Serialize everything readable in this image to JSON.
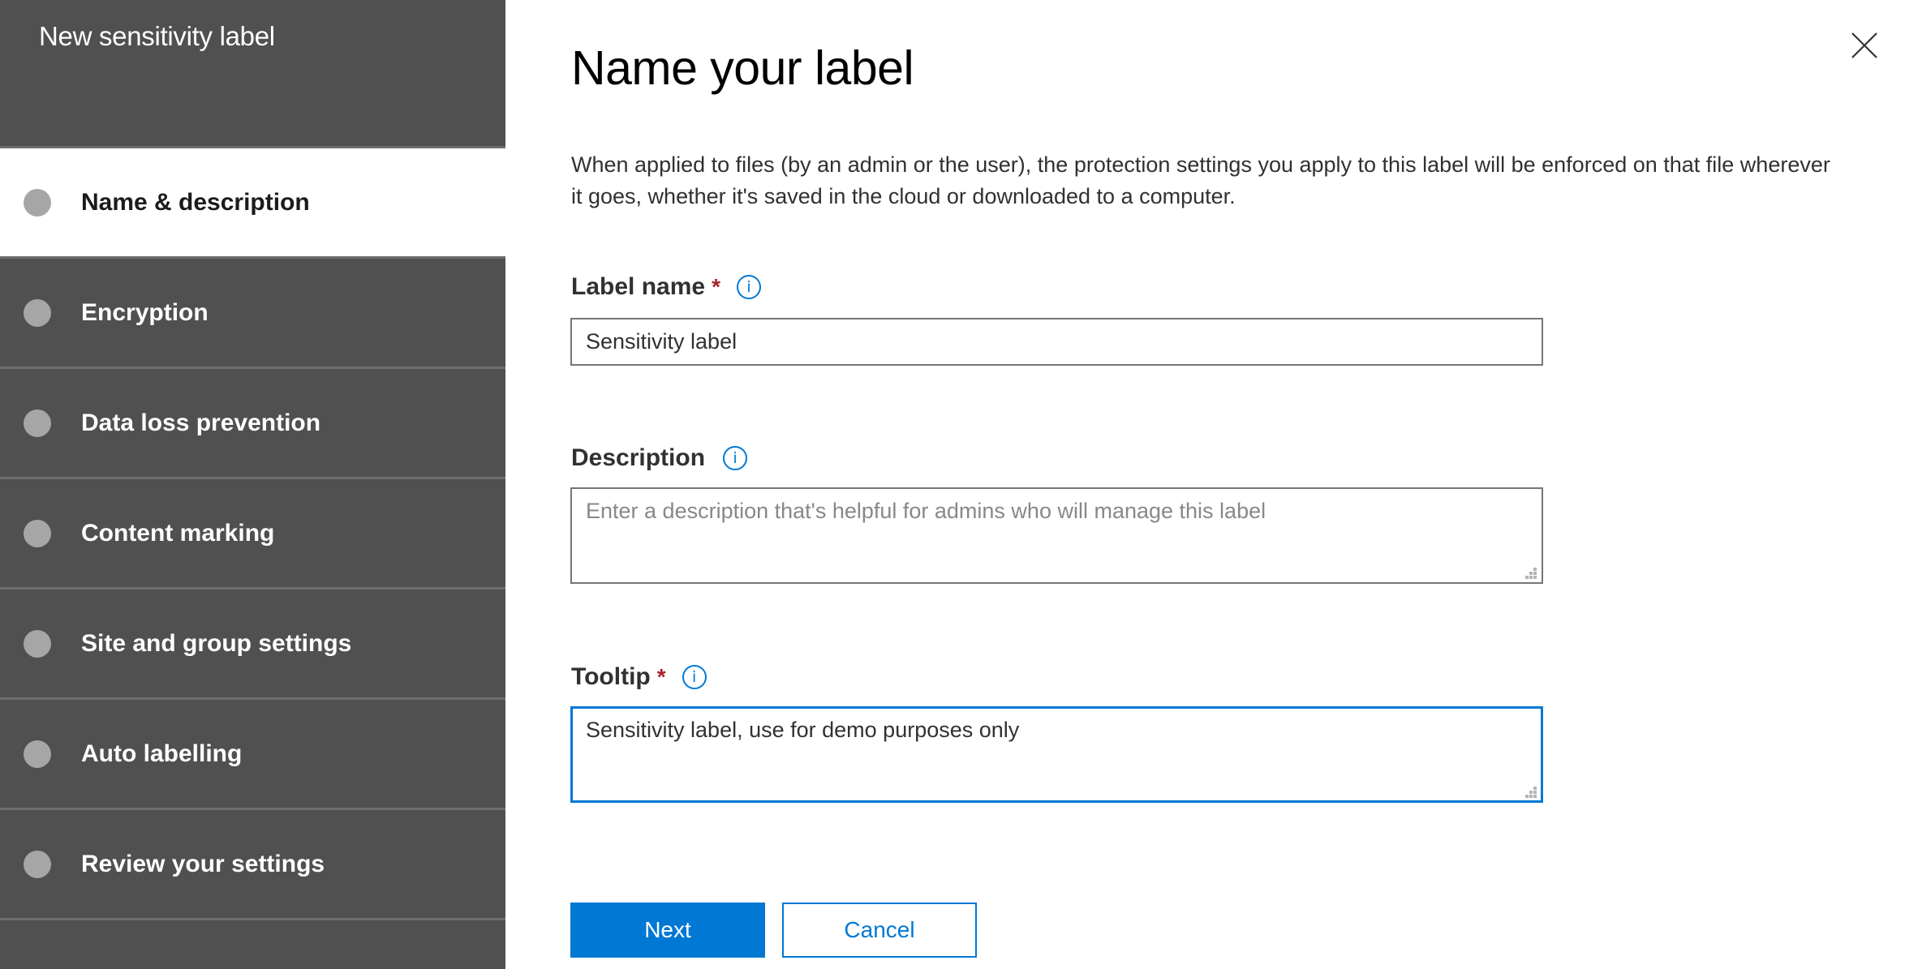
{
  "panel": {
    "title": "New sensitivity label"
  },
  "steps": [
    {
      "label": "Name & description",
      "active": true
    },
    {
      "label": "Encryption",
      "active": false
    },
    {
      "label": "Data loss prevention",
      "active": false
    },
    {
      "label": "Content marking",
      "active": false
    },
    {
      "label": "Site and group settings",
      "active": false
    },
    {
      "label": "Auto labelling",
      "active": false
    },
    {
      "label": "Review your settings",
      "active": false
    }
  ],
  "main": {
    "title": "Name your label",
    "intro": "When applied to files (by an admin or the user), the protection settings you apply to this label will be enforced on that file wherever it goes, whether it's saved in the cloud or downloaded to a computer.",
    "close_icon": "close-icon",
    "fields": {
      "label_name": {
        "label": "Label name",
        "required_mark": "*",
        "info_icon": "i",
        "value": "Sensitivity label",
        "placeholder": ""
      },
      "description": {
        "label": "Description",
        "info_icon": "i",
        "value": "",
        "placeholder": "Enter a description that's helpful for admins who will manage this label"
      },
      "tooltip": {
        "label": "Tooltip",
        "required_mark": "*",
        "info_icon": "i",
        "value": "Sensitivity label, use for demo purposes only",
        "placeholder": ""
      }
    },
    "buttons": {
      "next": "Next",
      "cancel": "Cancel"
    }
  },
  "colors": {
    "sidebar_bg": "#505050",
    "accent": "#0078d4",
    "required": "#a4262c",
    "step_dot": "#a6a6a6"
  }
}
